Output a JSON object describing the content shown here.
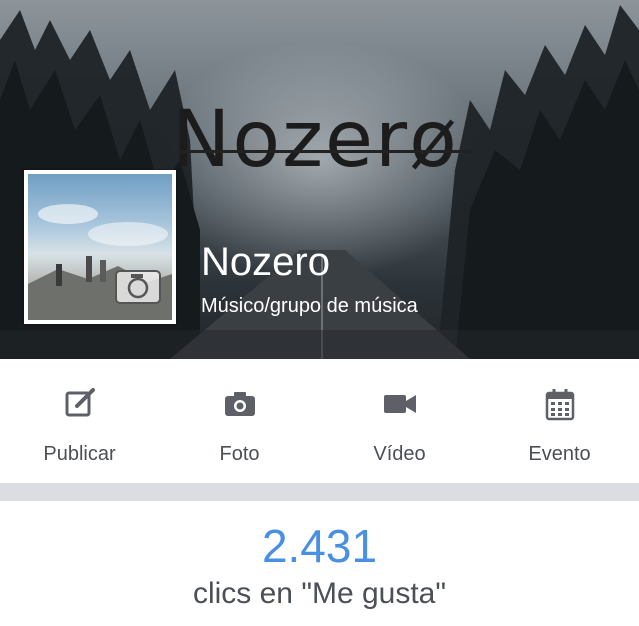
{
  "cover": {
    "wordmark": "Nozerø"
  },
  "page": {
    "name": "Nozero",
    "category": "Músico/grupo de música"
  },
  "actions": [
    {
      "label": "Publicar",
      "icon": "compose-icon"
    },
    {
      "label": "Foto",
      "icon": "camera-icon"
    },
    {
      "label": "Vídeo",
      "icon": "video-icon"
    },
    {
      "label": "Evento",
      "icon": "calendar-icon"
    }
  ],
  "likes": {
    "count": "2.431",
    "label": "clics en \"Me gusta\""
  },
  "colors": {
    "accent": "#4a90e2",
    "icon_gray": "#5d6167",
    "text_gray": "#4b4f56",
    "separator": "#dadde1"
  }
}
